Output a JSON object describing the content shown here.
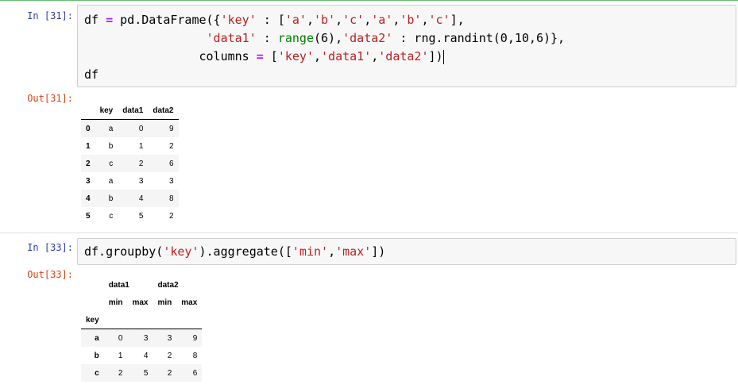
{
  "cell1": {
    "in_prompt": "In [31]:",
    "code_lines": [
      [
        "df ",
        "=",
        " pd.DataFrame({",
        "'key'",
        " : [",
        "'a'",
        ",",
        "'b'",
        ",",
        "'c'",
        ",",
        "'a'",
        ",",
        "'b'",
        ",",
        "'c'",
        "],"
      ],
      [
        "                 ",
        "'data1'",
        " : ",
        "range",
        "(6),",
        "'data2'",
        " : rng.randint(0,10,6)},"
      ],
      [
        "                columns ",
        "=",
        " [",
        "'key'",
        ",",
        "'data1'",
        ",",
        "'data2'",
        "])"
      ],
      [
        "df"
      ]
    ],
    "out_prompt": "Out[31]:",
    "table": {
      "columns": [
        "key",
        "data1",
        "data2"
      ],
      "rows": [
        {
          "index": "0",
          "key": "a",
          "data1": "0",
          "data2": "9"
        },
        {
          "index": "1",
          "key": "b",
          "data1": "1",
          "data2": "2"
        },
        {
          "index": "2",
          "key": "c",
          "data1": "2",
          "data2": "6"
        },
        {
          "index": "3",
          "key": "a",
          "data1": "3",
          "data2": "3"
        },
        {
          "index": "4",
          "key": "b",
          "data1": "4",
          "data2": "8"
        },
        {
          "index": "5",
          "key": "c",
          "data1": "5",
          "data2": "2"
        }
      ]
    }
  },
  "cell2": {
    "in_prompt": "In [33]:",
    "code_line": [
      "df.groupby(",
      "'key'",
      ").aggregate([",
      "'min'",
      ",",
      "'max'",
      "])"
    ],
    "out_prompt": "Out[33]:",
    "table": {
      "top_headers": [
        "data1",
        "data2"
      ],
      "sub_headers": [
        "min",
        "max",
        "min",
        "max"
      ],
      "index_name": "key",
      "rows": [
        {
          "index": "a",
          "values": [
            "0",
            "3",
            "3",
            "9"
          ]
        },
        {
          "index": "b",
          "values": [
            "1",
            "4",
            "2",
            "8"
          ]
        },
        {
          "index": "c",
          "values": [
            "2",
            "5",
            "2",
            "6"
          ]
        }
      ]
    }
  },
  "colors": {
    "in_prompt": "#303f9f",
    "out_prompt": "#d84315",
    "string": "#ba2121",
    "operator": "#aa22ff",
    "builtin": "#008000",
    "selected_border": "#42a5f5"
  }
}
